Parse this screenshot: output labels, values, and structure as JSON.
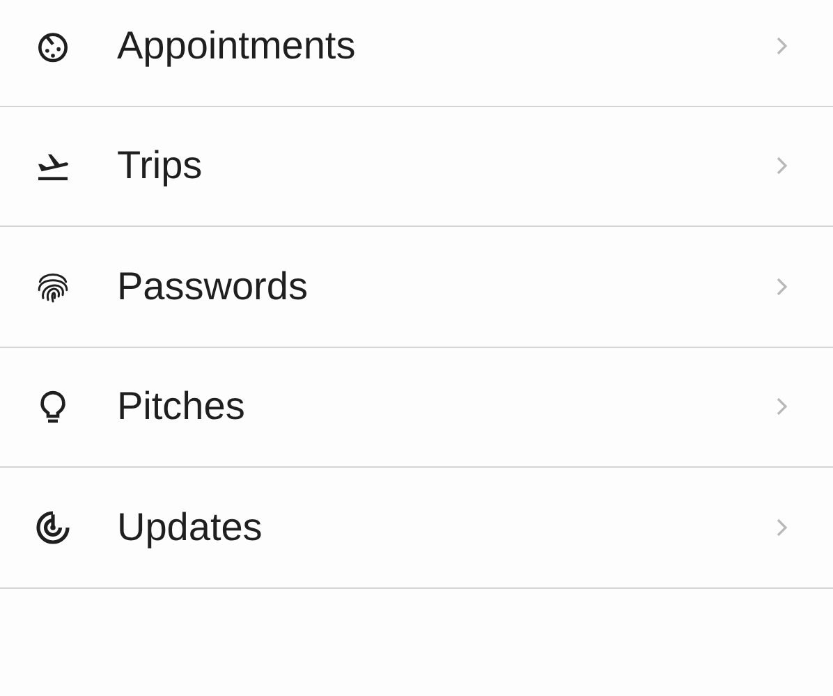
{
  "items": [
    {
      "label": "Appointments",
      "kind": "timer"
    },
    {
      "label": "Trips",
      "kind": "flight"
    },
    {
      "label": "Passwords",
      "kind": "fingerprint"
    },
    {
      "label": "Pitches",
      "kind": "bulb"
    },
    {
      "label": "Updates",
      "kind": "radar"
    }
  ]
}
